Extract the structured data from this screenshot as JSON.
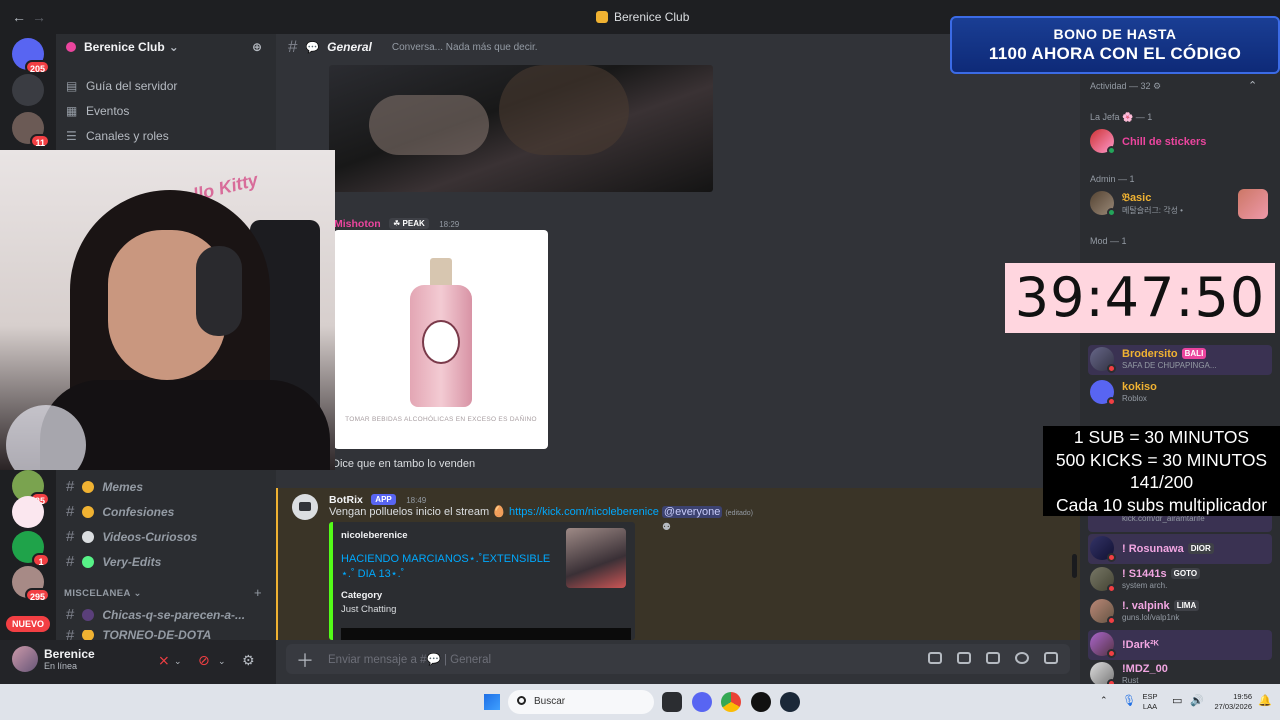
{
  "window": {
    "title": "Berenice Club"
  },
  "rail": {
    "badges": [
      "205",
      "11",
      "25",
      "1",
      "295"
    ],
    "new_label": "NUEVO",
    "icons": [
      "discord-home-icon",
      "server-icon"
    ]
  },
  "sidebar": {
    "server_name": "Berenice Club",
    "links": [
      {
        "label": "Guía del servidor",
        "icon": "guide-icon"
      },
      {
        "label": "Eventos",
        "icon": "calendar-icon"
      },
      {
        "label": "Canales y roles",
        "icon": "channels-roles-icon"
      }
    ],
    "channels": [
      {
        "label": "Memes"
      },
      {
        "label": "Confesiones"
      },
      {
        "label": "Videos-Curiosos"
      },
      {
        "label": "Very-Edits"
      }
    ],
    "category": "MISCELANEA",
    "category_channels": [
      {
        "label": "Chicas-q-se-parecen-a-..."
      },
      {
        "label": "TORNEO-DE-DOTA"
      }
    ]
  },
  "user_panel": {
    "name": "Berenice",
    "status": "En línea"
  },
  "channel": {
    "name": "General",
    "topic": "Conversa... Nada más que decir."
  },
  "messages": {
    "m1": {
      "author": "Mishoton",
      "badge": "PEAK",
      "time": "18:29",
      "image_warning": "TOMAR BEBIDAS ALCOHÓLICAS EN EXCESO ES DAÑINO",
      "text": "Dice que en tambo lo venden"
    },
    "m2": {
      "author": "BotRix",
      "app_tag": "APP",
      "time": "18:49",
      "text": "Vengan polluelos inicio el stream",
      "link": "https://kick.com/nicoleberenice",
      "mention": "@everyone",
      "edited": "(editado)",
      "embed": {
        "author": "nicoleberenice",
        "title": "HACIENDO MARCIANOS⋆.˚EXTENSIBLE ⋆.˚ DIA 13⋆.˚",
        "field_name": "Category",
        "field_value": "Just Chatting"
      }
    }
  },
  "composer": {
    "placeholder": "Enviar mensaje a #💬 | General"
  },
  "members": {
    "activity_header": "Actividad — 32",
    "groups": [
      {
        "title": "La Jefa 🌸 — 1",
        "members": [
          {
            "name": "Chill de stickers",
            "sub": "",
            "color": "#eb459e"
          }
        ]
      },
      {
        "title": "Admin — 1",
        "members": [
          {
            "name": "𝔅asic",
            "sub": "메탈슬러그: 각성 •",
            "color": "#f0b232"
          }
        ]
      },
      {
        "title": "Mod — 1",
        "members": []
      }
    ],
    "list": [
      {
        "name": "Brodersito",
        "tag": "BALI",
        "sub": "SAFA DE CHUPAPINGA...",
        "color": "#f0b232"
      },
      {
        "name": "kokiso",
        "tag": "",
        "sub": "Roblox",
        "color": "#f0b232"
      },
      {
        "name": "",
        "tag": "",
        "sub": "kick.com/dr_airamtarife",
        "color": "#dbdee1"
      },
      {
        "name": "! Rosunawa",
        "tag": "DIOR",
        "sub": "",
        "color": "#f2a6e2"
      },
      {
        "name": "! S1441s",
        "tag": "GOTO",
        "sub": "system arch.",
        "color": "#f2a6e2"
      },
      {
        "name": "!. valpink",
        "tag": "LIMA",
        "sub": "guns.lol/valp1nk",
        "color": "#f2a6e2"
      },
      {
        "name": "!Dark²ᴷ",
        "tag": "",
        "sub": "",
        "color": "#f2a6e2"
      },
      {
        "name": "!MDZ_00",
        "tag": "",
        "sub": "Rust",
        "color": "#f2a6e2"
      }
    ]
  },
  "overlays": {
    "promo_line1": "BONO DE HASTA",
    "promo_line2": "1100 AHORA CON EL CÓDIGO",
    "timer": "39:47:50",
    "subs_lines": [
      "1 SUB     = 30 MINUTOS",
      "500 KICKS = 30 MINUTOS",
      "141/200",
      "Cada 10 subs multiplicador"
    ]
  },
  "taskbar": {
    "search_placeholder": "Buscar",
    "lang1": "ESP",
    "lang2": "LAA",
    "time": "19:56",
    "date": "27/03/2026"
  },
  "colors": {
    "accent_kick": "#53fc18",
    "mention_bg": "#3a3427",
    "brand_blue": "#5865f2",
    "danger": "#f23f43"
  }
}
